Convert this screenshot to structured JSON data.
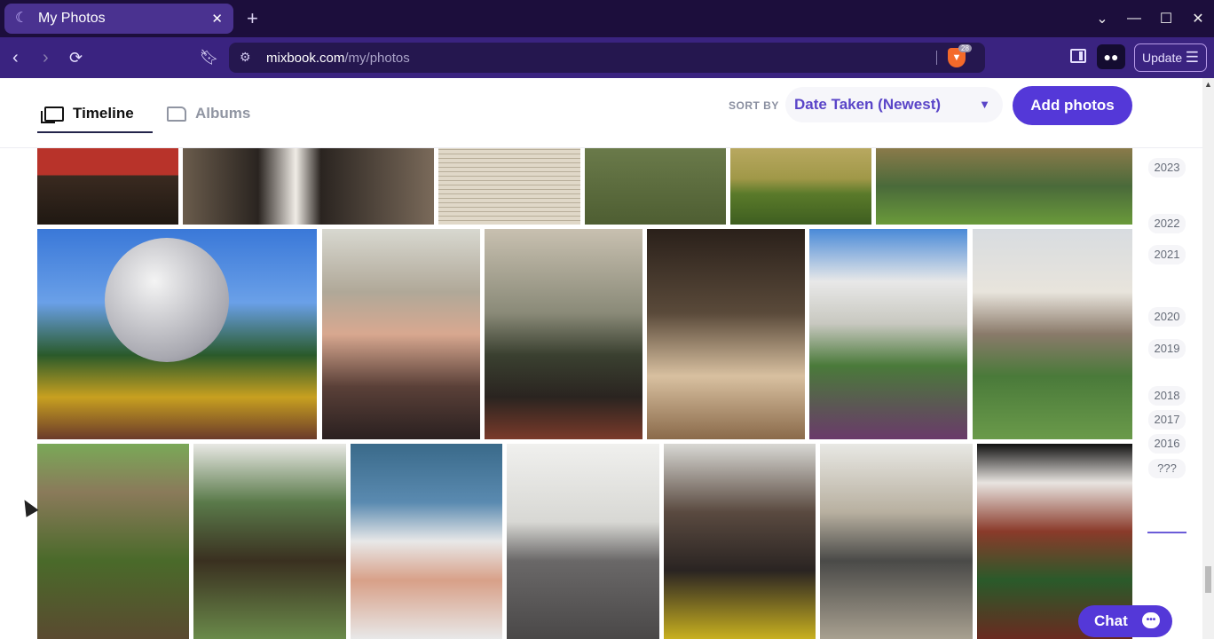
{
  "browser": {
    "tab_title": "My Photos",
    "new_tab": "+",
    "url_domain": "mixbook.com",
    "url_path": "/my/photos",
    "brave_count": "28",
    "update_label": "Update"
  },
  "header": {
    "tabs": [
      {
        "label": "Timeline",
        "active": true
      },
      {
        "label": "Albums",
        "active": false
      }
    ],
    "sort_label": "SORT BY",
    "sort_value": "Date Taken (Newest)",
    "add_photos": "Add photos"
  },
  "timeline_years": [
    "2023",
    "2022",
    "2021",
    "2020",
    "2019",
    "2018",
    "2017",
    "2016",
    "???"
  ],
  "chat_label": "Chat",
  "colors": {
    "accent": "#5438d8",
    "tab_strip": "#1c0e3c",
    "nav_bar": "#3a2380"
  },
  "photos": [
    {
      "name": "photo-red-cloth",
      "fill": "#8a2a22"
    },
    {
      "name": "photo-wedding",
      "fill": "#4a4038"
    },
    {
      "name": "photo-newspaper",
      "fill": "#d8cfbd"
    },
    {
      "name": "photo-river",
      "fill": "#5e7040"
    },
    {
      "name": "photo-grass-bank",
      "fill": "#8a8f40"
    },
    {
      "name": "photo-kids-group",
      "fill": "#6f8a3a"
    },
    {
      "name": "photo-epcot",
      "fill": "#4a7ac8"
    },
    {
      "name": "photo-selfie-couple",
      "fill": "#8a6a5a"
    },
    {
      "name": "photo-living-room",
      "fill": "#6a6858"
    },
    {
      "name": "photo-restaurant-couple",
      "fill": "#4a3a2a"
    },
    {
      "name": "photo-house-garden",
      "fill": "#5a7a48"
    },
    {
      "name": "photo-porch-house",
      "fill": "#7a8a68"
    },
    {
      "name": "photo-boy-corn",
      "fill": "#5f7a3a"
    },
    {
      "name": "photo-gardening",
      "fill": "#6a6040"
    },
    {
      "name": "photo-pool-boy",
      "fill": "#5a8aa0"
    },
    {
      "name": "photo-elephant-barn",
      "fill": "#8a8888"
    },
    {
      "name": "photo-elephant-family",
      "fill": "#6a6058"
    },
    {
      "name": "photo-giraffe-family",
      "fill": "#8a8478"
    },
    {
      "name": "photo-holiday-door",
      "fill": "#4a2a22"
    }
  ]
}
